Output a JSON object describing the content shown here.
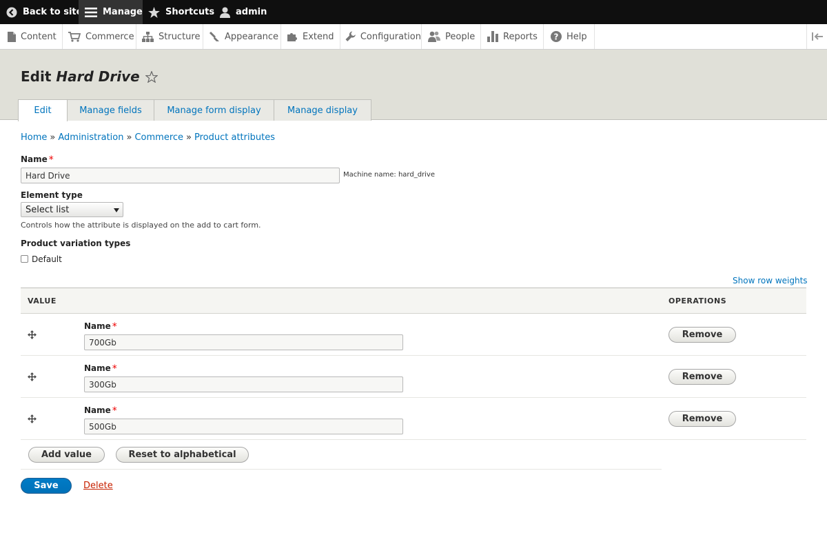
{
  "toolbar": {
    "back_label": "Back to site",
    "manage_label": "Manage",
    "shortcuts_label": "Shortcuts",
    "user_label": "admin"
  },
  "tray": {
    "items": [
      {
        "label": "Content",
        "icon": "file-icon"
      },
      {
        "label": "Commerce",
        "icon": "cart-icon"
      },
      {
        "label": "Structure",
        "icon": "sitemap-icon"
      },
      {
        "label": "Appearance",
        "icon": "brush-icon"
      },
      {
        "label": "Extend",
        "icon": "puzzle-icon"
      },
      {
        "label": "Configuration",
        "icon": "wrench-icon"
      },
      {
        "label": "People",
        "icon": "people-icon"
      },
      {
        "label": "Reports",
        "icon": "bar-chart-icon"
      },
      {
        "label": "Help",
        "icon": "help-icon"
      }
    ]
  },
  "page": {
    "title_prefix": "Edit",
    "title_name": "Hard Drive",
    "tabs": [
      "Edit",
      "Manage fields",
      "Manage form display",
      "Manage display"
    ]
  },
  "breadcrumb": {
    "items": [
      "Home",
      "Administration",
      "Commerce",
      "Product attributes"
    ],
    "separator": "»"
  },
  "form": {
    "name_label": "Name",
    "required_mark": "*",
    "name_value": "Hard Drive",
    "machine_name": "Machine name: hard_drive",
    "element_type_label": "Element type",
    "element_type_value": "Select list",
    "element_type_desc": "Controls how the attribute is displayed on the add to cart form.",
    "variation_types_label": "Product variation types",
    "variation_default_label": "Default",
    "variation_default_checked": false
  },
  "values_table": {
    "show_row_weights": "Show row weights",
    "col_value": "VALUE",
    "col_operations": "OPERATIONS",
    "row_label": "Name",
    "remove_label": "Remove",
    "rows": [
      "700Gb",
      "300Gb",
      "500Gb"
    ]
  },
  "actions": {
    "add_value": "Add value",
    "reset_alpha": "Reset to alphabetical",
    "save": "Save",
    "delete": "Delete"
  },
  "colors": {
    "link": "#0074bd",
    "primary_button": "#0071b8",
    "required": "#e00000",
    "delete_link": "#c72100",
    "header_bg": "#e0e0d8"
  }
}
